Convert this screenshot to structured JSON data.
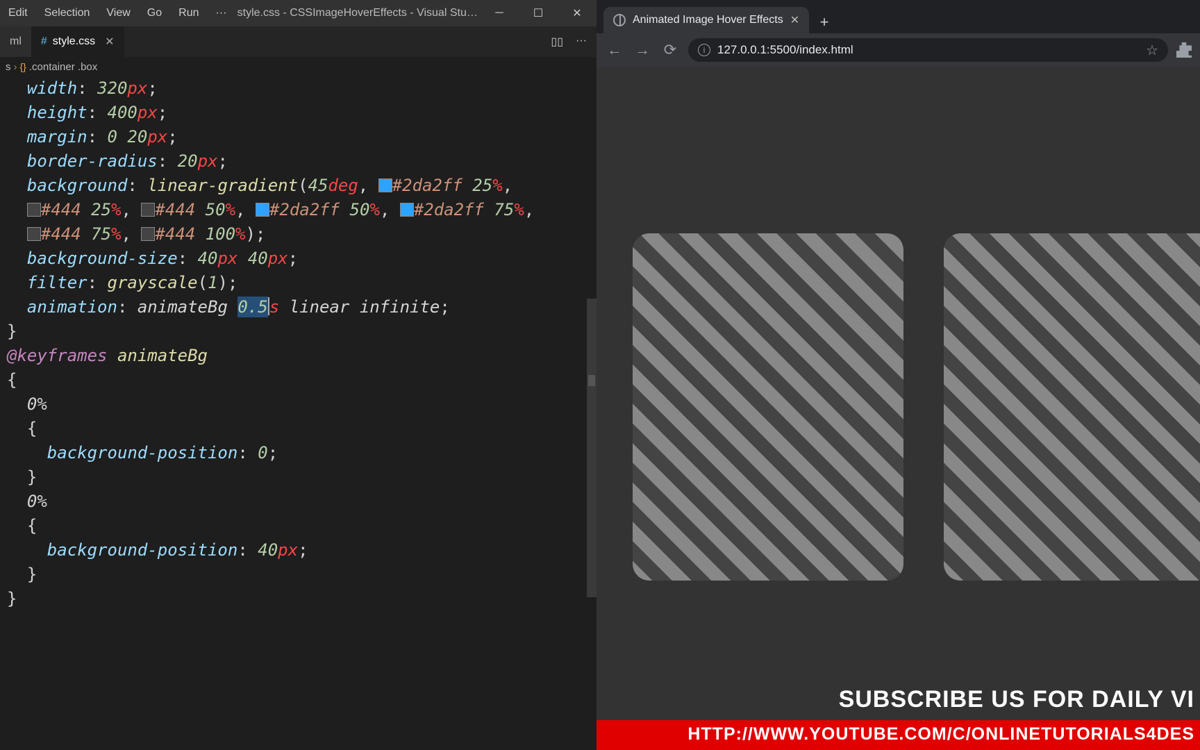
{
  "vscode": {
    "menu": [
      "Edit",
      "Selection",
      "View",
      "Go",
      "Run",
      "···"
    ],
    "title": "style.css - CSSImageHoverEffects - Visual Stu…",
    "tabs": {
      "left": "ml",
      "active": "style.css"
    },
    "breadcrumb": {
      "file": "s",
      "selector": ".container .box"
    },
    "code": {
      "width": {
        "prop": "width",
        "val": "320",
        "unit": "px"
      },
      "height": {
        "prop": "height",
        "val": "400",
        "unit": "px"
      },
      "margin": {
        "prop": "margin",
        "a": "0",
        "b": "20",
        "unit": "px"
      },
      "radius": {
        "prop": "border-radius",
        "val": "20",
        "unit": "px"
      },
      "bg": {
        "prop": "background",
        "func": "linear-gradient",
        "deg": "45",
        "degu": "deg"
      },
      "stops": {
        "c1": "#2da2ff",
        "p1": "25",
        "c2": "#444",
        "p2": "25",
        "c3": "#444",
        "p3": "50",
        "c4": "#2da2ff",
        "p4": "50",
        "c5": "#2da2ff",
        "p5": "75",
        "c6": "#444",
        "p6": "75",
        "c7": "#444",
        "p7": "100"
      },
      "bgsize": {
        "prop": "background-size",
        "a": "40",
        "b": "40",
        "unit": "px"
      },
      "filter": {
        "prop": "filter",
        "func": "grayscale",
        "arg": "1"
      },
      "anim": {
        "prop": "animation",
        "name": "animateBg",
        "dur": "0.5",
        "duru": "s",
        "timing": "linear",
        "iter": "infinite"
      },
      "kf": {
        "at": "@keyframes",
        "name": "animateBg"
      },
      "k0a": {
        "pct": "0%",
        "prop": "background-position",
        "val": "0"
      },
      "k0b": {
        "pct": "0%",
        "prop": "background-position",
        "val": "40",
        "unit": "px"
      }
    }
  },
  "browser": {
    "tab_title": "Animated Image Hover Effects",
    "url": "127.0.0.1:5500/index.html",
    "subscribe": "SUBSCRIBE US FOR DAILY VI",
    "yt": "HTTP://WWW.YOUTUBE.COM/C/ONLINETUTORIALS4DES"
  }
}
